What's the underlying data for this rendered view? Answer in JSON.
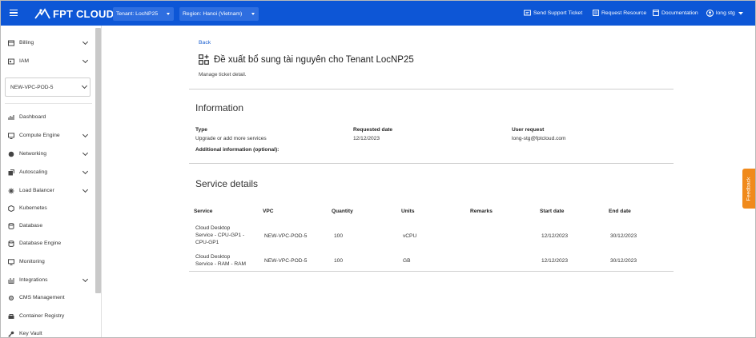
{
  "header": {
    "logo_text": "FPT CLOUD",
    "tenant_select": "Tenant: LocNP25",
    "region_select": "Region: Hanoi (Vietnam)",
    "links": {
      "support": "Send Support Ticket",
      "request": "Request Resource",
      "docs": "Documentation",
      "user": "long stg"
    }
  },
  "sidebar": {
    "billing": "Billing",
    "iam": "IAM",
    "vpc_select": "NEW-VPC-POD-5",
    "items": {
      "dashboard": "Dashboard",
      "compute": "Compute Engine",
      "networking": "Networking",
      "autoscaling": "Autoscaling",
      "lb": "Load Balancer",
      "k8s": "Kubernetes",
      "database": "Database",
      "dbengine": "Database Engine",
      "monitoring": "Monitoring",
      "integrations": "Integrations",
      "cms": "CMS Management",
      "registry": "Container Registry",
      "keyvault": "Key Vault"
    }
  },
  "page": {
    "back": "Back",
    "title": "Đề xuất bổ sung tài nguyên cho Tenant LocNP25",
    "subtitle": "Manage ticket detail.",
    "info_title": "Information",
    "type_label": "Type",
    "type_value": "Upgrade or add more services",
    "req_date_label": "Requested date",
    "req_date_value": "12/12/2023",
    "user_label": "User request",
    "user_value": "long-stg@fptcloud.com",
    "additional_label": "Additional information (optional):",
    "service_title": "Service details",
    "columns": {
      "service": "Service",
      "vpc": "VPC",
      "quantity": "Quantity",
      "units": "Units",
      "remarks": "Remarks",
      "start": "Start date",
      "end": "End date"
    },
    "rows": [
      {
        "service_l1": "Cloud Desktop",
        "service_l2": "Service - CPU-GP1 -",
        "service_l3": "CPU-GP1",
        "vpc": "NEW-VPC-POD-5",
        "quantity": "100",
        "units": "vCPU",
        "remarks": "",
        "start": "12/12/2023",
        "end": "30/12/2023"
      },
      {
        "service_l1": "Cloud Desktop",
        "service_l2": "Service - RAM - RAM",
        "vpc": "NEW-VPC-POD-5",
        "quantity": "100",
        "units": "GB",
        "remarks": "",
        "start": "12/12/2023",
        "end": "30/12/2023"
      }
    ]
  },
  "feedback": "Feedback",
  "colors": {
    "brand": "#0d56d6",
    "feedback": "#f08a1c",
    "link": "#1a5fd0"
  }
}
